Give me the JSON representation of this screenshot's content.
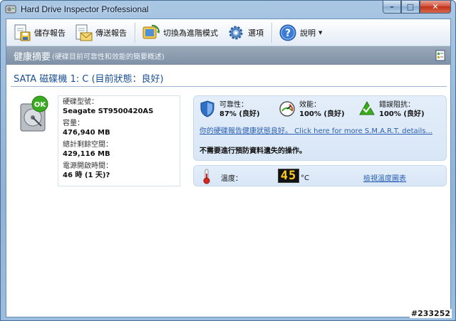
{
  "window": {
    "title": "Hard Drive Inspector Professional",
    "minimize_glyph": "–",
    "maximize_glyph": "□",
    "close_glyph": "✕"
  },
  "toolbar": {
    "save_report": "儲存報告",
    "send_report": "傳送報告",
    "switch_mode": "切換為進階模式",
    "options": "選項",
    "help": "說明"
  },
  "section": {
    "title": "健康摘要",
    "subtitle": "(硬碟目前可靠性和效能的簡要概述)"
  },
  "drive": {
    "title": "SATA 磁碟機 1: C (目前狀態：良好)",
    "badge": "OK",
    "model_label": "硬碟型號：",
    "model_value": "Seagate ST9500420AS",
    "capacity_label": "容量：",
    "capacity_value": "476,940 MB",
    "free_label": "總計剩餘空間：",
    "free_value": "429,116 MB",
    "power_on_label": "電源開啟時間：",
    "power_on_value": "46 時 (1 天)?"
  },
  "status": {
    "reliability_label": "可靠性：",
    "reliability_value": "87% (良好)",
    "performance_label": "效能：",
    "performance_value": "100% (良好)",
    "errors_label": "錯誤阻抗：",
    "errors_value": "100% (良好)",
    "smart_link": "你的硬碟報告健康狀態良好。 Click here for more S.M.A.R.T. details...",
    "advice": "不需要進行預防資料遺失的操作。"
  },
  "temperature": {
    "label": "溫度：",
    "value": "45",
    "unit": "°C",
    "link": "檢視溫度圖表"
  },
  "watermark": "#233252",
  "colors": {
    "accent_link": "#2a5fb4",
    "ok_green": "#3bab1f",
    "shield_blue": "#2f6fc6",
    "temp_digits": "#ffcc1a"
  }
}
